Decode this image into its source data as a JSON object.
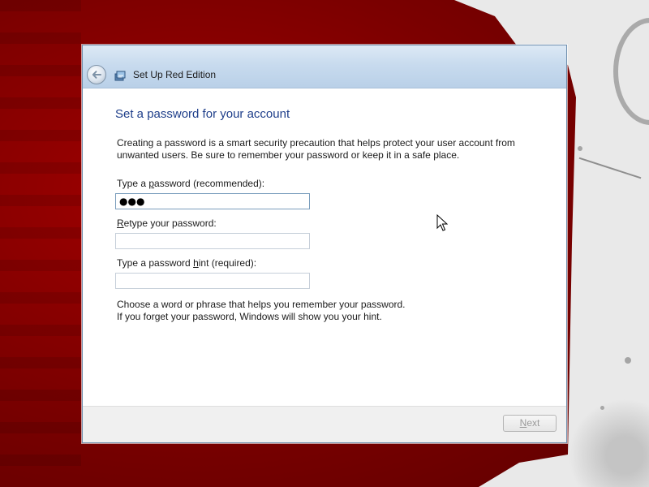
{
  "window": {
    "title": "Set Up Red Edition"
  },
  "page": {
    "heading": "Set a password for your account",
    "description": "Creating a password is a smart security precaution that helps protect your user account from unwanted users. Be sure to remember your password or keep it in a safe place."
  },
  "fields": {
    "password": {
      "label_before": "Type a ",
      "label_accel": "p",
      "label_after": "assword (recommended):",
      "value": "●●●"
    },
    "retype": {
      "label_accel": "R",
      "label_after": "etype your password:",
      "value": ""
    },
    "hint": {
      "label_before": "Type a password ",
      "label_accel": "h",
      "label_after": "int (required):",
      "value": ""
    }
  },
  "hint_note": {
    "line1": "Choose a word or phrase that helps you remember your password.",
    "line2": "If you forget your password, Windows will show you your hint."
  },
  "footer": {
    "next_accel": "N",
    "next_rest": "ext"
  },
  "icons": {
    "back": "back-arrow-icon",
    "setup": "setup-icon"
  }
}
